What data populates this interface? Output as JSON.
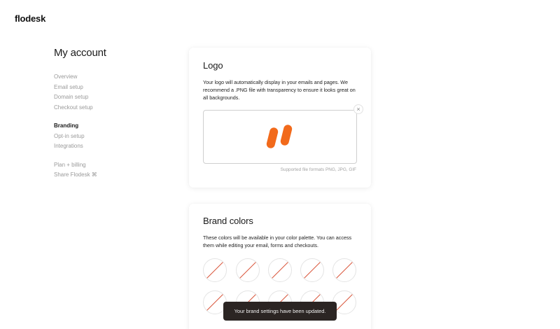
{
  "app": {
    "brand": "flodesk"
  },
  "page": {
    "title": "My account"
  },
  "nav": {
    "groups": [
      [
        "Overview",
        "Email setup",
        "Domain setup",
        "Checkout setup"
      ],
      [
        "Branding",
        "Opt-in setup",
        "Integrations"
      ],
      [
        "Plan + billing",
        "Share Flodesk ⌘"
      ]
    ],
    "active": "Branding"
  },
  "logo_card": {
    "title": "Logo",
    "description": "Your logo will automatically display in your emails and pages. We recommend a .PNG file with transparency to ensure it looks great on all backgrounds.",
    "remove_icon": "close-icon",
    "remove_label": "×",
    "formats": "Supported file formats PNG, JPG, GIF",
    "logo_color": "#f26a1b"
  },
  "colors_card": {
    "title": "Brand colors",
    "description": "These colors will be available in your color palette. You can access them while editing your email, forms and checkouts.",
    "swatch_count": 10,
    "empty_slash_color": "#d9553a"
  },
  "toast": {
    "message": "Your brand settings have been updated."
  }
}
